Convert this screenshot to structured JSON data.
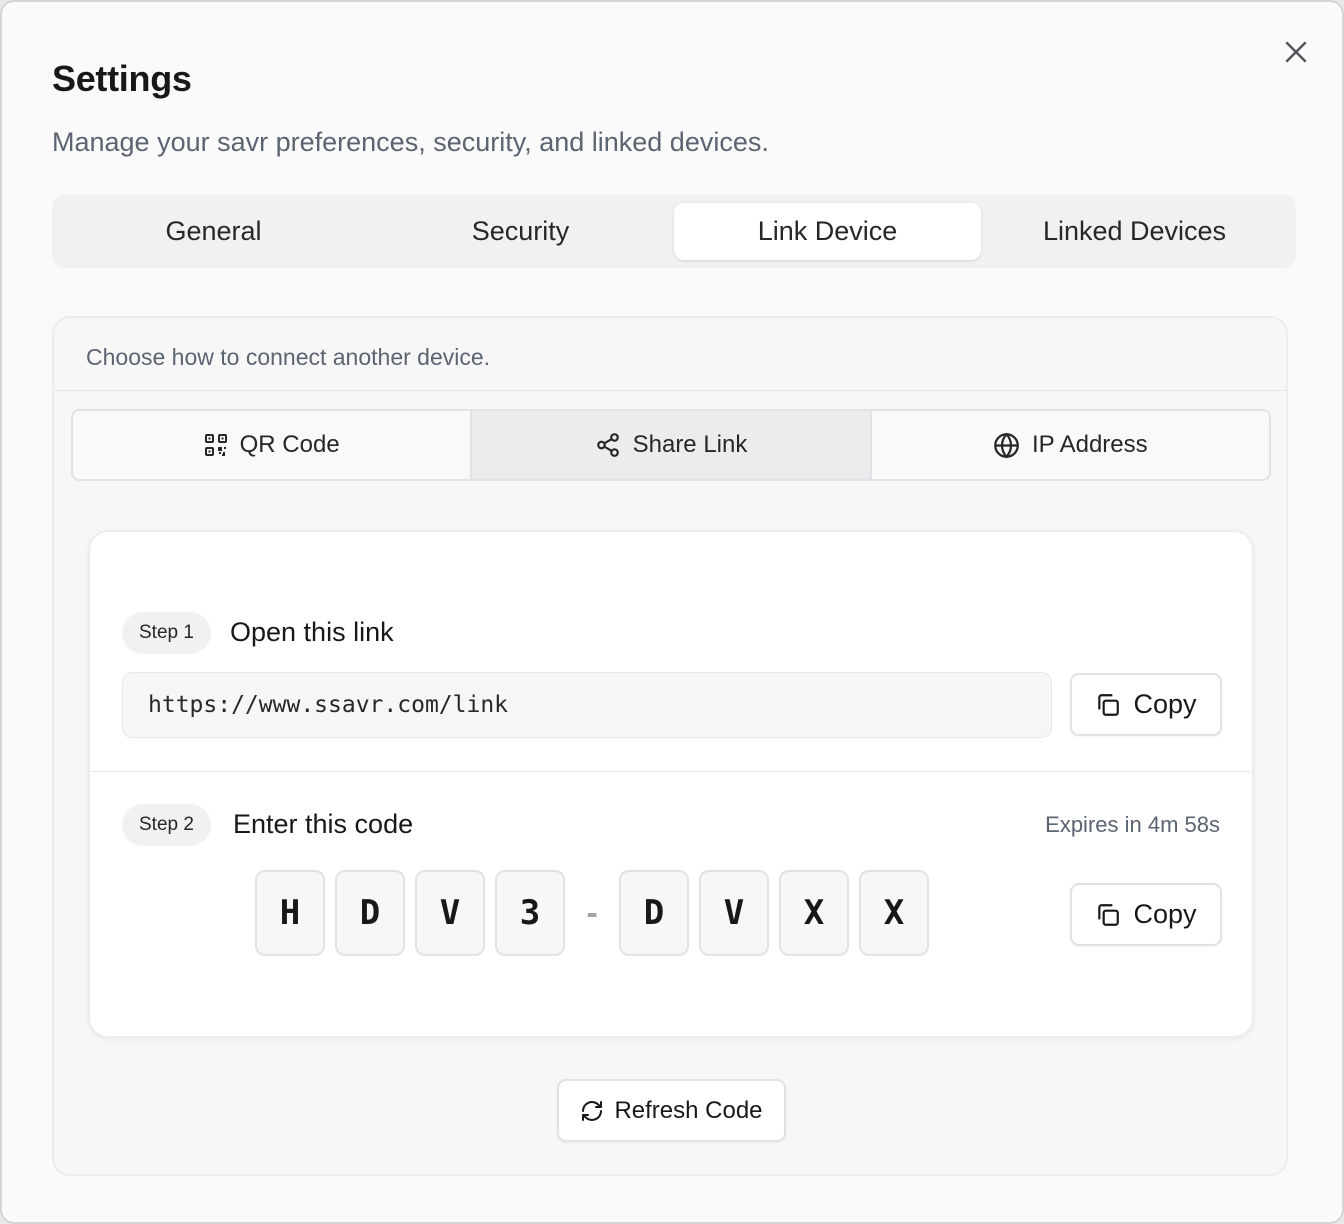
{
  "dialog": {
    "title": "Settings",
    "subtitle": "Manage your savr preferences, security, and linked devices."
  },
  "tabs": [
    {
      "label": "General",
      "active": false
    },
    {
      "label": "Security",
      "active": false
    },
    {
      "label": "Link Device",
      "active": true
    },
    {
      "label": "Linked Devices",
      "active": false
    }
  ],
  "link_device": {
    "description": "Choose how to connect another device.",
    "methods": [
      {
        "label": "QR Code",
        "icon": "qr-code-icon",
        "active": false
      },
      {
        "label": "Share Link",
        "icon": "share-icon",
        "active": true
      },
      {
        "label": "IP Address",
        "icon": "globe-icon",
        "active": false
      }
    ],
    "step1": {
      "badge": "Step 1",
      "title": "Open this link",
      "link": "https://www.ssavr.com/link",
      "copy_label": "Copy"
    },
    "step2": {
      "badge": "Step 2",
      "title": "Enter this code",
      "expires": "Expires in 4m 58s",
      "code_part1": [
        "H",
        "D",
        "V",
        "3"
      ],
      "separator": "-",
      "code_part2": [
        "D",
        "V",
        "X",
        "X"
      ],
      "copy_label": "Copy"
    },
    "refresh_label": "Refresh Code"
  },
  "colors": {
    "background": "#fafafa",
    "muted_text": "#5b6472",
    "border": "#e1e2e5",
    "active_tab": "#ffffff"
  }
}
